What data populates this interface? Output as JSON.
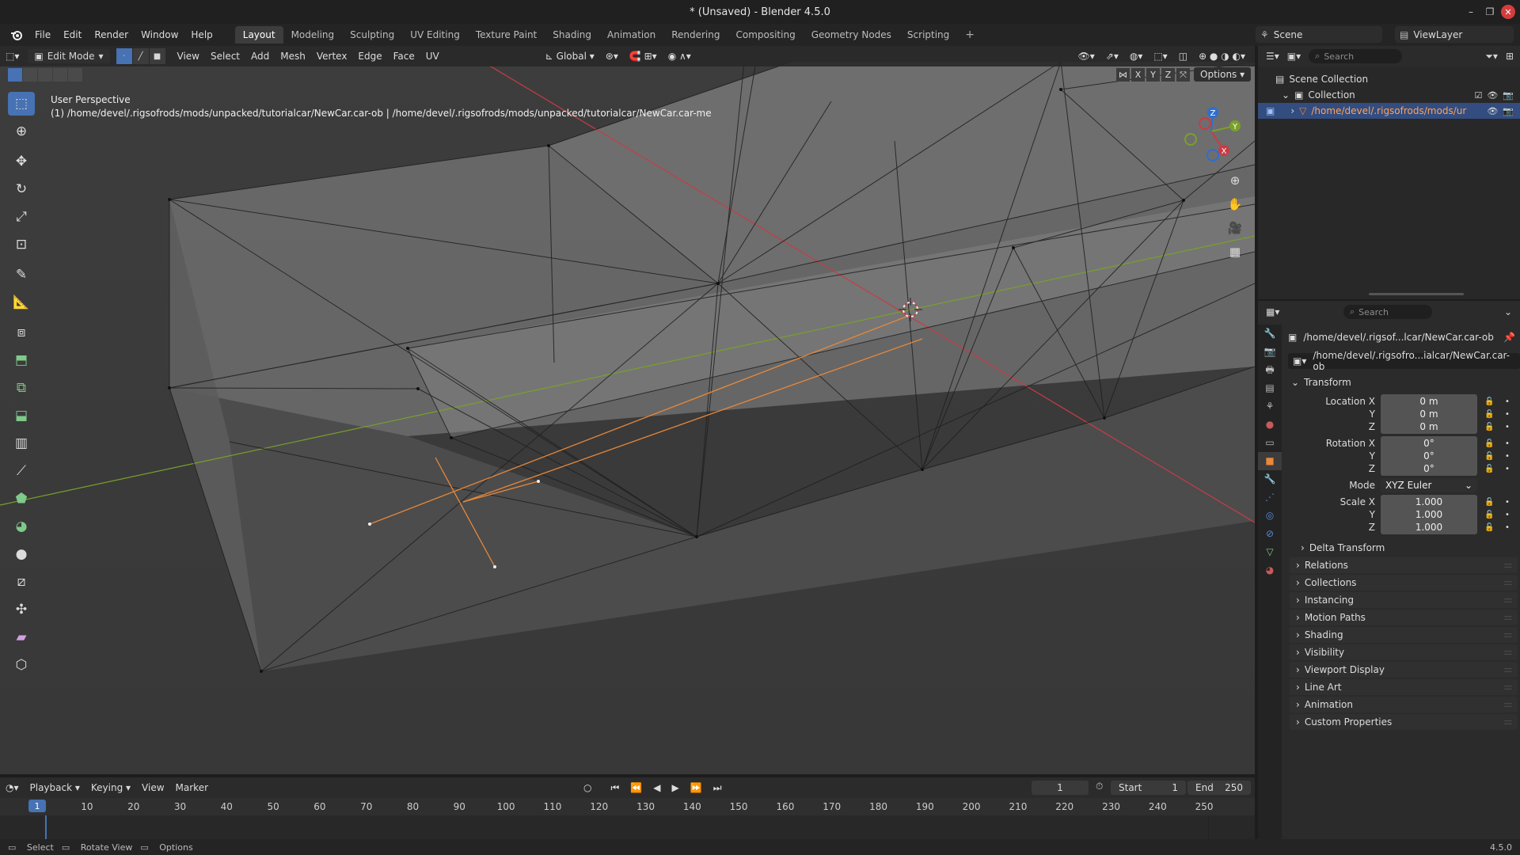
{
  "window": {
    "title": "* (Unsaved) - Blender 4.5.0",
    "controls": [
      "–",
      "❐",
      "✕"
    ]
  },
  "menu": [
    "File",
    "Edit",
    "Render",
    "Window",
    "Help"
  ],
  "workspaces": [
    "Layout",
    "Modeling",
    "Sculpting",
    "UV Editing",
    "Texture Paint",
    "Shading",
    "Animation",
    "Rendering",
    "Compositing",
    "Geometry Nodes",
    "Scripting"
  ],
  "active_workspace": "Layout",
  "scene": {
    "name": "Scene",
    "view_layer": "ViewLayer"
  },
  "viewport": {
    "mode": "Edit Mode",
    "menus": [
      "View",
      "Select",
      "Add",
      "Mesh",
      "Vertex",
      "Edge",
      "Face",
      "UV"
    ],
    "orientation": "Global",
    "perspective_label": "User Perspective",
    "object_info": "(1) /home/devel/.rigsofrods/mods/unpacked/tutorialcar/NewCar.car-ob | /home/devel/.rigsofrods/mods/unpacked/tutorialcar/NewCar.car-me",
    "axis_buttons": [
      "X",
      "Y",
      "Z"
    ],
    "options_label": "Options",
    "gizmo_axes": {
      "x": "X",
      "y": "Y",
      "z": "Z"
    }
  },
  "timeline": {
    "menus": [
      "Playback",
      "Keying",
      "View",
      "Marker"
    ],
    "current_frame": "1",
    "start_label": "Start",
    "start": "1",
    "end_label": "End",
    "end": "250",
    "ticks": [
      "1",
      "10",
      "20",
      "30",
      "40",
      "50",
      "60",
      "70",
      "80",
      "90",
      "100",
      "110",
      "120",
      "130",
      "140",
      "150",
      "160",
      "170",
      "180",
      "190",
      "200",
      "210",
      "220",
      "230",
      "240",
      "250"
    ]
  },
  "statusbar": {
    "items": [
      "Select",
      "Rotate View",
      "Options"
    ],
    "version": "4.5.0"
  },
  "outliner": {
    "search_placeholder": "Search",
    "rows": [
      "Scene Collection",
      "Collection",
      "/home/devel/.rigsofrods/mods/ur"
    ]
  },
  "properties": {
    "search_placeholder": "Search",
    "object_path": "/home/devel/.rigsof...lcar/NewCar.car-ob",
    "object_name": "/home/devel/.rigsofro...ialcar/NewCar.car-ob",
    "transform_title": "Transform",
    "location": {
      "label": "Location X",
      "y_label": "Y",
      "z_label": "Z",
      "x": "0 m",
      "y": "0 m",
      "z": "0 m"
    },
    "rotation": {
      "label": "Rotation X",
      "y_label": "Y",
      "z_label": "Z",
      "x": "0°",
      "y": "0°",
      "z": "0°"
    },
    "mode_label": "Mode",
    "mode_value": "XYZ Euler",
    "scale": {
      "label": "Scale X",
      "y_label": "Y",
      "z_label": "Z",
      "x": "1.000",
      "y": "1.000",
      "z": "1.000"
    },
    "delta_transform": "Delta Transform",
    "panels": [
      "Relations",
      "Collections",
      "Instancing",
      "Motion Paths",
      "Shading",
      "Visibility",
      "Viewport Display",
      "Line Art",
      "Animation",
      "Custom Properties"
    ]
  },
  "colors": {
    "accent": "#4772b3",
    "axis_x": "#c83c46",
    "axis_y": "#7aa02a",
    "selected_edge": "#e8883a",
    "viewport_bg": "#3a3a3a"
  }
}
